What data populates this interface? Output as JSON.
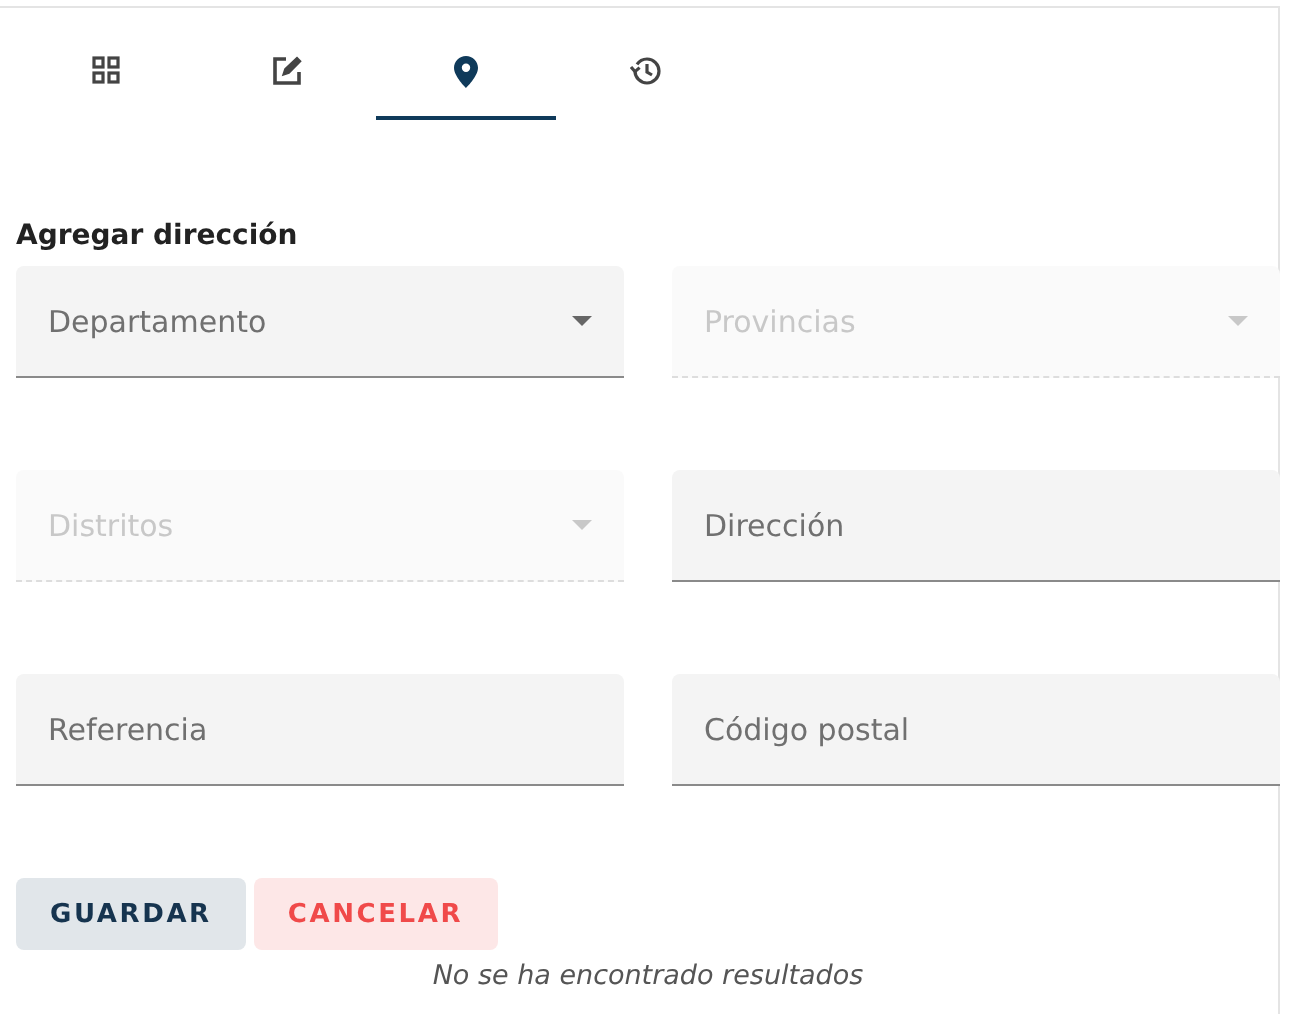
{
  "tabs": [
    {
      "kind": "grid",
      "selected": false
    },
    {
      "kind": "edit",
      "selected": false
    },
    {
      "kind": "location",
      "selected": true
    },
    {
      "kind": "history",
      "selected": false
    }
  ],
  "form": {
    "title": "Agregar dirección",
    "fields": [
      {
        "kind": "select",
        "placeholder": "Departamento",
        "disabled": false
      },
      {
        "kind": "select",
        "placeholder": "Provincias",
        "disabled": true
      },
      {
        "kind": "select",
        "placeholder": "Distritos",
        "disabled": true
      },
      {
        "kind": "text",
        "placeholder": "Dirección",
        "disabled": false
      },
      {
        "kind": "text",
        "placeholder": "Referencia",
        "disabled": false
      },
      {
        "kind": "text",
        "placeholder": "Código postal",
        "disabled": false
      }
    ]
  },
  "buttons": [
    {
      "kind": "primary",
      "label": "GUARDAR"
    },
    {
      "kind": "danger",
      "label": "CANCELAR"
    }
  ],
  "message": "No se ha encontrado resultados"
}
